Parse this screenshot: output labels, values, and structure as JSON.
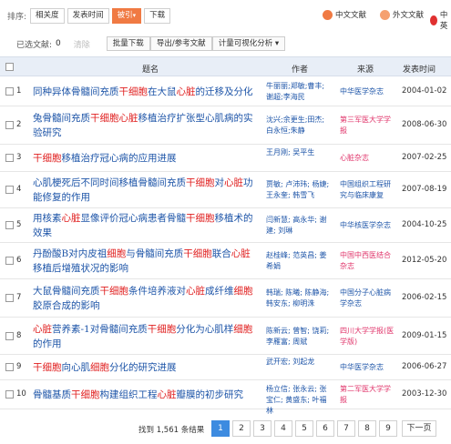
{
  "sort": {
    "label": "排序:",
    "options": [
      "相关度",
      "发表时间",
      "被引",
      "下载"
    ],
    "active_suffix": "▾"
  },
  "languages": [
    {
      "label": "中文文献",
      "icon": "cn-globe-icon",
      "color": "#f07a43"
    },
    {
      "label": "外文文献",
      "icon": "foreign-globe-icon",
      "color": "#f07a43"
    },
    {
      "label": "中英",
      "icon": "cn-en-icon",
      "color": "#e03030"
    }
  ],
  "toolbar": {
    "selected_label": "已选文献:",
    "selected_count": "0",
    "clear": "清除",
    "buttons": [
      "批量下载",
      "导出/参考文献",
      "计量可视化分析 ▾"
    ]
  },
  "table": {
    "headers": {
      "title": "题名",
      "author": "作者",
      "source": "来源",
      "date": "发表时间"
    },
    "rows": [
      {
        "num": "1",
        "title": [
          [
            "同种异体骨髓间充质",
            0
          ],
          [
            "干细胞",
            1
          ],
          [
            "在大鼠",
            0
          ],
          [
            "心脏",
            1
          ],
          [
            "的迁移及分化",
            0
          ]
        ],
        "author": "牛丽丽;郑敏;曹丰;谢超;李海民",
        "source": "中华医学杂志",
        "source_red": false,
        "date": "2004-01-02"
      },
      {
        "num": "2",
        "title": [
          [
            "兔骨髓间充质",
            0
          ],
          [
            "干细胞心脏",
            1
          ],
          [
            "移植治疗扩张型心肌病的实验研究",
            0
          ]
        ],
        "author": "沈兴;余更生;田杰;白永恒;朱静",
        "source": "第三军医大学学报",
        "source_red": true,
        "date": "2008-06-30"
      },
      {
        "num": "3",
        "title": [
          [
            "干细胞",
            1
          ],
          [
            "移植治疗冠心病的应用进展",
            0
          ]
        ],
        "author": "王月刚; 吴平生",
        "source": "心脏杂志",
        "source_red": true,
        "date": "2007-02-25"
      },
      {
        "num": "4",
        "title": [
          [
            "心肌梗死后不同时间移植骨髓间充质",
            0
          ],
          [
            "干细胞",
            1
          ],
          [
            "对",
            0
          ],
          [
            "心脏",
            1
          ],
          [
            "功能修复的作用",
            0
          ]
        ],
        "author": "贾敏; 卢沛玮; 杨婕; 王永奎; 韩雪飞",
        "source": "中国组织工程研究与临床康复",
        "source_red": false,
        "date": "2007-08-19"
      },
      {
        "num": "5",
        "title": [
          [
            "用核素",
            0
          ],
          [
            "心脏",
            1
          ],
          [
            "显像评价冠心病患者骨髓",
            0
          ],
          [
            "干细胞",
            1
          ],
          [
            "移植术的效果",
            0
          ]
        ],
        "author": "闫新慧; 高永华; 谢建; 刘琳",
        "source": "中华核医学杂志",
        "source_red": false,
        "date": "2004-10-25"
      },
      {
        "num": "6",
        "title": [
          [
            "丹酚酸B对内皮祖",
            0
          ],
          [
            "细胞",
            1
          ],
          [
            "与骨髓间充质",
            0
          ],
          [
            "干细胞",
            1
          ],
          [
            "联合",
            0
          ],
          [
            "心脏",
            1
          ],
          [
            "移植后增殖状况的影响",
            0
          ]
        ],
        "author": "赵桂峰; 范英昌; 姜希娟",
        "source": "中国中西医结合杂志",
        "source_red": true,
        "date": "2012-05-20"
      },
      {
        "num": "7",
        "title": [
          [
            "大鼠骨髓间充质",
            0
          ],
          [
            "干细胞",
            1
          ],
          [
            "条件培养液对",
            0
          ],
          [
            "心脏",
            1
          ],
          [
            "成纤维",
            0
          ],
          [
            "细胞",
            1
          ],
          [
            "胶原合成的影响",
            0
          ]
        ],
        "author": "韩瑞; 陈曦; 陈静海; 韩安东; 柳明洙",
        "source": "中国分子心脏病学杂志",
        "source_red": false,
        "date": "2006-02-15"
      },
      {
        "num": "8",
        "title": [
          [
            "心脏",
            1
          ],
          [
            "营养素-1对骨髓间充质",
            0
          ],
          [
            "干细胞",
            1
          ],
          [
            "分化为心肌样",
            0
          ],
          [
            "细胞",
            1
          ],
          [
            "的作用",
            0
          ]
        ],
        "author": "陈新云; 曾智; 饶莉; 李雁富; 周斌",
        "source": "四川大学学报(医学版)",
        "source_red": true,
        "date": "2009-01-15"
      },
      {
        "num": "9",
        "title": [
          [
            "干细胞",
            1
          ],
          [
            "向心肌",
            0
          ],
          [
            "细胞",
            1
          ],
          [
            "分化的研究进展",
            0
          ]
        ],
        "author": "武开宏; 刘起龙",
        "source": "中华医学杂志",
        "source_red": false,
        "date": "2006-06-27"
      },
      {
        "num": "10",
        "title": [
          [
            "骨髓基质",
            0
          ],
          [
            "干细胞",
            1
          ],
          [
            "构建组织工程",
            0
          ],
          [
            "心脏",
            1
          ],
          [
            "瓣膜的初步研究",
            0
          ]
        ],
        "author": "杨立信; 张永云; 张宝仁; 黄盛东; 叶福林",
        "source": "第二军医大学学报",
        "source_red": true,
        "date": "2003-12-30"
      }
    ]
  },
  "pager": {
    "found": "找到 1,561 条结果",
    "pages": [
      "1",
      "2",
      "3",
      "4",
      "5",
      "6",
      "7",
      "8",
      "9"
    ],
    "current": "1",
    "next": "下一页"
  }
}
